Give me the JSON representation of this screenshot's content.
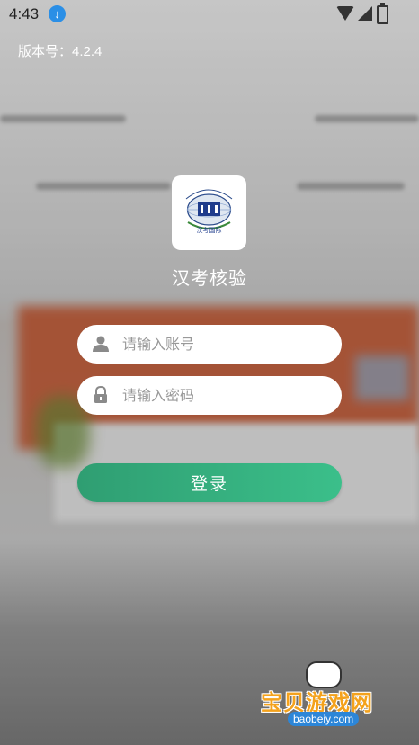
{
  "status_bar": {
    "time": "4:43",
    "download_icon": "download-icon",
    "wifi_icon": "wifi-icon",
    "signal_icon": "signal-icon",
    "battery_icon": "battery-icon"
  },
  "version_label": "版本号：4.2.4",
  "app": {
    "title": "汉考核验",
    "logo_icon": "chinese-testing-international-logo",
    "logo_caption": "汉考国际",
    "logo_ring_text": "CHINESE TESTING INTERNATIONAL"
  },
  "form": {
    "account_placeholder": "请输入账号",
    "account_value": "",
    "password_placeholder": "请输入密码",
    "password_value": "",
    "login_label": "登录"
  },
  "watermark": {
    "text": "宝贝游戏网",
    "url": "baobeiy.com"
  },
  "colors": {
    "accent_start": "#2f9e72",
    "accent_end": "#3bbf8a"
  }
}
